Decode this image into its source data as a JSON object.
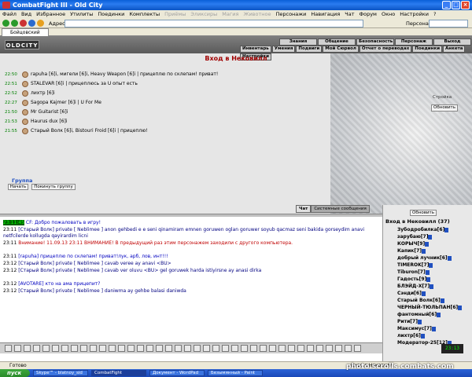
{
  "window": {
    "title": "CombatFight III - Old City"
  },
  "menu": {
    "items": [
      "Файл",
      "Вид",
      "Избранное",
      "Утилиты",
      "Поединки",
      "Комплекты",
      "Приёмы",
      "Эликсиры",
      "Магия",
      "Животное",
      "Персонажи",
      "Навигация",
      "Чат",
      "Форум",
      "Окно",
      "Настройки",
      "?"
    ],
    "disabled": [
      false,
      false,
      false,
      false,
      false,
      false,
      true,
      true,
      true,
      true,
      false,
      false,
      false,
      false,
      false,
      false,
      false
    ]
  },
  "address": {
    "label": "Адрес",
    "value": "",
    "persons_label": "Персонаж:"
  },
  "tab": {
    "label": "Бойцовский клуб"
  },
  "game": {
    "logo": "OLDCITY",
    "top_nav": [
      "Знания",
      "Общение",
      "Безопасность",
      "Персонаж",
      "Выход"
    ],
    "sub_nav": [
      "Инвентарь",
      "Умения",
      "Подвиги",
      "Мой Сюрвол",
      "Отчет о переводах",
      "Поединки",
      "Анкета",
      "Настройки"
    ],
    "room_title": "Вход в Нековилл",
    "side_label": "Стройка",
    "refresh": "Обновить",
    "posts": [
      {
        "time": "22:50",
        "text": "rapuha [6]i, мигели [6]i, Heavy Weapon [6]i | прицеплю по склепам! приват!"
      },
      {
        "time": "22:51",
        "text": "STALEVAR [6]i | прицеплюсь за U опыт есть"
      },
      {
        "time": "22:52",
        "text": "лихтр [6]i"
      },
      {
        "time": "22:27",
        "text": "Sagopa Kajmer [6]i | U For Me"
      },
      {
        "time": "21:50",
        "text": "Mr Guitarist [6]i"
      },
      {
        "time": "21:53",
        "text": "Haurus dux [6]i"
      },
      {
        "time": "21:55",
        "text": "Старый Волк [6]i, Bistouri Froid [6]i | прицеплю!"
      }
    ],
    "group": {
      "label": "Группа",
      "start": "Начать",
      "leave": "Покинуть группу"
    }
  },
  "chat_tabs": [
    "Чат",
    "Системные сообщения"
  ],
  "chat": [
    {
      "time": "23:11:45",
      "sys": true,
      "text": "CF: Добро пожаловать в игру!"
    },
    {
      "time": "23:11",
      "text": "[Старый Волк] private [ Neblimee ] anon gehbedi e e seni qinamiram emnen goruwen oglan goruwer soyub qacmaz seni bakida gorseydim anavi netfcilerde kollugda qayirardim licni"
    },
    {
      "time": "23:11",
      "text": "Внимание! 11.09.13 23:11 ВНИМАНИЕ! В предыдущий раз этим персонажем заходили с другого компьютера."
    },
    {
      "time": "23:11",
      "text": "[rapuha] прицеплю по склепам! приват!лук, арб, лов, инт!!!"
    },
    {
      "time": "23:12",
      "text": "[Старый Волк] private [ Neblimee ] cavab veree ay anavi <BU>"
    },
    {
      "time": "23:12",
      "text": "[Старый Волк] private [ Neblimee ] cavab ver oluvu <BU> gel goruwek harda istiyirsne ay anasi dirka"
    },
    {
      "time": "23:12",
      "text": "[AVOTARE] кто на ама прицепит?"
    },
    {
      "time": "23:12",
      "text": "[Старый Волк] private [ Neblimee ] daniwma ay gehbe balasi daniwda"
    }
  ],
  "online": {
    "refresh": "Обновить",
    "title": "Вход в Нековилл (37)",
    "users": [
      "Зубодробилка[6]",
      "зарубаю[7]",
      "КОРЫЧ[9]",
      "Капик[7]",
      "добрый лучник[6]",
      "TIMEROK[7]",
      "Tiburon[7]",
      "Гадость[9]",
      "БЛЭЙД-Х[7]",
      "Сэнди[6]",
      "Старый Волк[6]",
      "ЧЕРНЫЙ-ТЮЛЬПАН[6]",
      "фантомный[6]",
      "Рити[7]",
      "Максимус[7]",
      "лихтр[6]",
      "Модератор-25[12]"
    ]
  },
  "clock": "23:13",
  "status": {
    "text": "Готово",
    "location": "Вход в Нековилл"
  },
  "taskbar": {
    "start": "пуск",
    "items": [
      "Skype™ - blatnoy_sid",
      "CombatFight",
      "Документ - WordPad",
      "Безымянный - Paint"
    ]
  },
  "watermark": "photo.scrolls.combats.com"
}
